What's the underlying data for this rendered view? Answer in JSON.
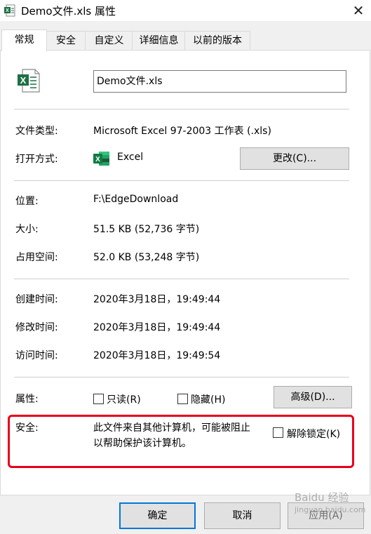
{
  "window": {
    "title": "Demo文件.xls 属性",
    "close_glyph": "✕"
  },
  "tabs": [
    {
      "label": "常规",
      "active": true
    },
    {
      "label": "安全",
      "active": false
    },
    {
      "label": "自定义",
      "active": false
    },
    {
      "label": "详细信息",
      "active": false
    },
    {
      "label": "以前的版本",
      "active": false
    }
  ],
  "general": {
    "file_icon": "excel-file-icon",
    "filename": "Demo文件.xls",
    "file_type_label": "文件类型:",
    "file_type_value": "Microsoft Excel 97-2003 工作表 (.xls)",
    "opens_with_label": "打开方式:",
    "opens_with_app": "Excel",
    "opens_with_icon": "excel-app-icon",
    "change_button": "更改(C)...",
    "location_label": "位置:",
    "location_value": "F:\\EdgeDownload",
    "size_label": "大小:",
    "size_value": "51.5 KB (52,736 字节)",
    "size_on_disk_label": "占用空间:",
    "size_on_disk_value": "52.0 KB (53,248 字节)",
    "created_label": "创建时间:",
    "created_value": "2020年3月18日，19:49:44",
    "modified_label": "修改时间:",
    "modified_value": "2020年3月18日，19:49:44",
    "accessed_label": "访问时间:",
    "accessed_value": "2020年3月18日，19:49:54",
    "attributes_label": "属性:",
    "readonly_label": "只读(R)",
    "readonly_checked": false,
    "hidden_label": "隐藏(H)",
    "hidden_checked": false,
    "advanced_button": "高级(D)...",
    "security_label": "安全:",
    "security_text_line1": "此文件来自其他计算机，可能被阻止",
    "security_text_line2": "以帮助保护该计算机。",
    "unblock_label": "解除锁定(K)",
    "unblock_checked": false
  },
  "footer": {
    "ok_button": "确定",
    "cancel_button": "取消",
    "apply_button": "应用(A)"
  },
  "watermark": {
    "line1": "Baidu 经验",
    "line2": "jingyan.baidu.com"
  },
  "colors": {
    "highlight_box": "#e8001a",
    "excel_green": "#1d7044",
    "accent": "#0078d7"
  }
}
